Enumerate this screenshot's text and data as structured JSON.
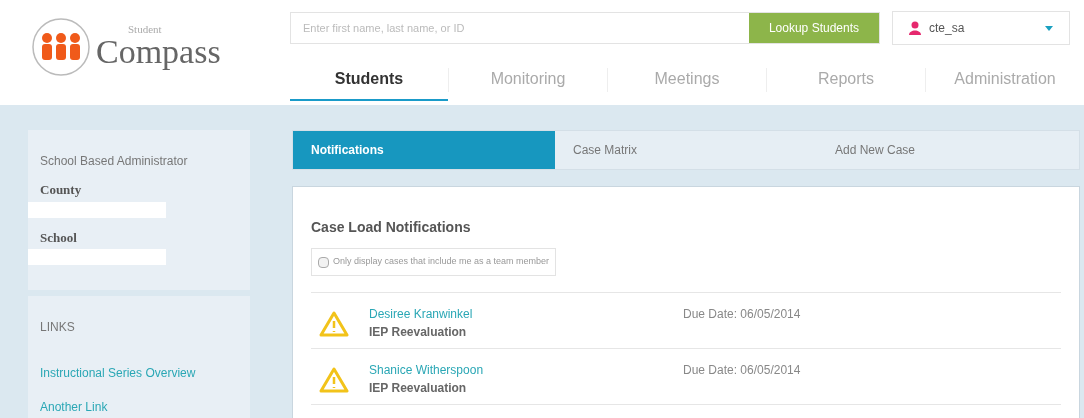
{
  "logo": {
    "small": "Student",
    "large": "Compass"
  },
  "search": {
    "placeholder": "Enter first name, last name, or ID",
    "button": "Lookup Students"
  },
  "user": {
    "name": "cte_sa"
  },
  "nav": [
    {
      "label": "Students",
      "selected": true
    },
    {
      "label": "Monitoring",
      "selected": false
    },
    {
      "label": "Meetings",
      "selected": false
    },
    {
      "label": "Reports",
      "selected": false
    },
    {
      "label": "Administration",
      "selected": false
    }
  ],
  "sidebar": {
    "role": "School Based Administrator",
    "fields": [
      "County",
      "School"
    ],
    "links_title": "LINKS",
    "links": [
      "Instructional Series Overview",
      "Another Link"
    ]
  },
  "tabs": [
    {
      "label": "Notifications",
      "selected": true
    },
    {
      "label": "Case Matrix",
      "selected": false
    },
    {
      "label": "Add New Case",
      "selected": false
    }
  ],
  "panel": {
    "title": "Case Load Notifications",
    "filter": {
      "label": "Only display cases that include me as a team member",
      "checked": false
    },
    "notifications": [
      {
        "name": "Desiree Kranwinkel",
        "type": "IEP Reevaluation",
        "due": "Due Date: 06/05/2014"
      },
      {
        "name": "Shanice Witherspoon",
        "type": "IEP Reevaluation",
        "due": "Due Date: 06/05/2014"
      }
    ]
  }
}
